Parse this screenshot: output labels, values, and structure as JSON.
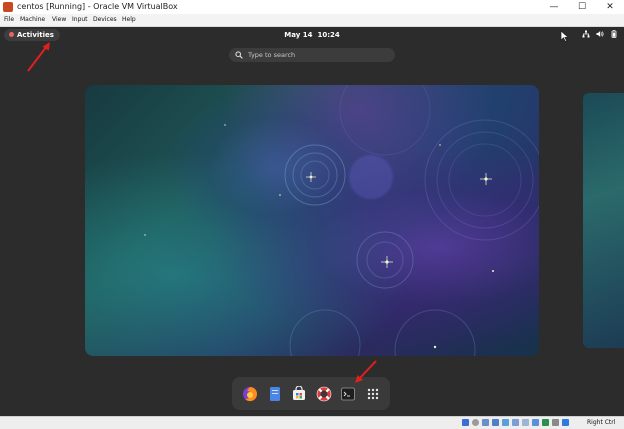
{
  "window": {
    "title": "centos [Running] - Oracle VM VirtualBox",
    "minimize_glyph": "—",
    "maximize_glyph": "☐",
    "close_glyph": "✕"
  },
  "menu": {
    "items": [
      {
        "label": "File"
      },
      {
        "label": "Machine"
      },
      {
        "label": "View"
      },
      {
        "label": "Input"
      },
      {
        "label": "Devices"
      },
      {
        "label": "Help"
      }
    ]
  },
  "topbar": {
    "activities_label": "Activities",
    "date": "May 14",
    "time": "10:24",
    "tray_icons": [
      "network-icon",
      "volume-icon",
      "battery-icon"
    ]
  },
  "search": {
    "placeholder": "Type to search",
    "value": ""
  },
  "dock": {
    "items": [
      {
        "name": "firefox-icon"
      },
      {
        "name": "files-icon"
      },
      {
        "name": "software-icon"
      },
      {
        "name": "help-icon"
      },
      {
        "name": "terminal-icon"
      },
      {
        "name": "app-grid-icon"
      }
    ]
  },
  "statusbar": {
    "host_key_label": "Right Ctrl"
  },
  "colors": {
    "desktop": "#2c2c2c",
    "dock": "#3a3a3a",
    "annotation_arrow": "#e0201e",
    "vbox_accent": "#c8491f"
  }
}
